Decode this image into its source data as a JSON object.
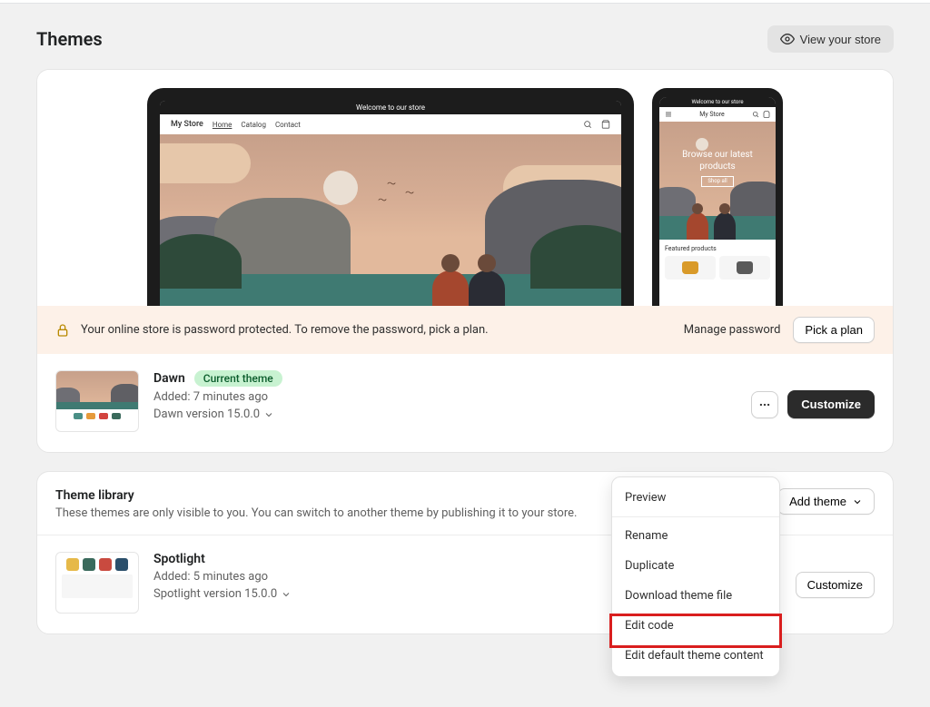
{
  "page": {
    "title": "Themes",
    "view_store": "View your store"
  },
  "preview": {
    "announcement": "Welcome to our store",
    "store_name": "My Store",
    "nav": {
      "home": "Home",
      "catalog": "Catalog",
      "contact": "Contact"
    },
    "mobile_hero_line1": "Browse our latest",
    "mobile_hero_line2": "products",
    "mobile_shop_all": "Shop all",
    "mobile_featured_label": "Featured products",
    "mobile_tee_colors": [
      "#d99a29",
      "#5a5a5a"
    ]
  },
  "password_banner": {
    "text": "Your online store is password protected. To remove the password, pick a plan.",
    "manage_label": "Manage password",
    "pick_plan_label": "Pick a plan"
  },
  "current_theme": {
    "name": "Dawn",
    "badge": "Current theme",
    "added": "Added: 7 minutes ago",
    "version": "Dawn version 15.0.0",
    "customize_label": "Customize",
    "swatch_colors": [
      "#4a8f86",
      "#e69a3b",
      "#d2433e",
      "#3a6a5c"
    ]
  },
  "library": {
    "title": "Theme library",
    "subtitle": "These themes are only visible to you. You can switch to another theme by publishing it to your store.",
    "add_label": "Add theme",
    "themes": [
      {
        "name": "Spotlight",
        "added": "Added: 5 minutes ago",
        "version": "Spotlight version 15.0.0",
        "customize_label": "Customize",
        "tee_colors": [
          "#e6b949",
          "#3a6a5c",
          "#c94a3f",
          "#2b4f6b"
        ]
      }
    ]
  },
  "menu": {
    "preview": "Preview",
    "rename": "Rename",
    "duplicate": "Duplicate",
    "download": "Download theme file",
    "edit_code": "Edit code",
    "edit_default": "Edit default theme content"
  }
}
